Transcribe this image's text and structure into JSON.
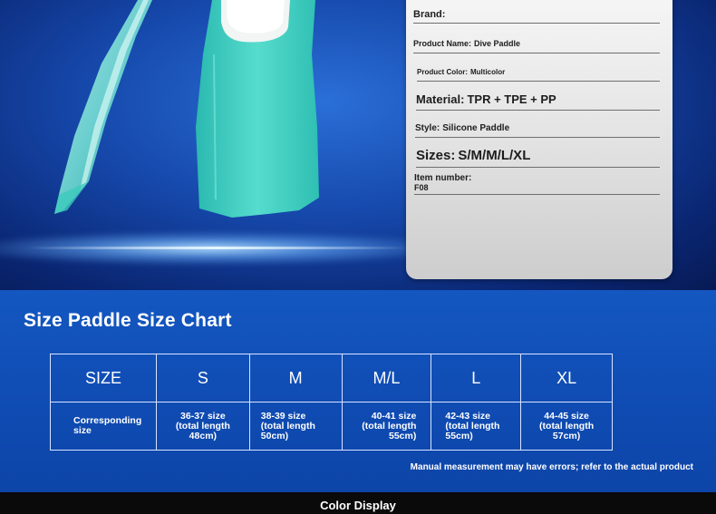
{
  "product_card": {
    "brand_label": "Brand:",
    "product_name_label": "Product Name:",
    "product_name_value": "Dive Paddle",
    "product_color_label": "Product Color:",
    "product_color_value": "Multicolor",
    "material_label": "Material:",
    "material_value": "TPR + TPE + PP",
    "style_label": "Style:",
    "style_value": "Silicone Paddle",
    "sizes_label": "Sizes:",
    "sizes_value": "S/M/M/L/XL",
    "item_number_label": "Item number:",
    "item_number_value": "F08"
  },
  "size_chart": {
    "title": "Size Paddle Size Chart",
    "header_label": "SIZE",
    "row_label": "Corresponding size",
    "columns": [
      {
        "size": "S",
        "shoe": "36-37 size",
        "length": "(total length 48cm)"
      },
      {
        "size": "M",
        "shoe": "38-39 size",
        "length": "(total length 50cm)"
      },
      {
        "size": "M/L",
        "shoe": "40-41 size",
        "length": "(total length 55cm)"
      },
      {
        "size": "L",
        "shoe": "42-43 size",
        "length": "(total length 55cm)"
      },
      {
        "size": "XL",
        "shoe": "44-45 size",
        "length": "(total length 57cm)"
      }
    ],
    "note": "Manual measurement may have errors; refer to the actual product"
  },
  "footer": {
    "section_label": "Color Display"
  },
  "colors": {
    "fin_color": "#3fd1c3",
    "chart_background": "#1457c1",
    "card_background": "#e6e6e6"
  }
}
